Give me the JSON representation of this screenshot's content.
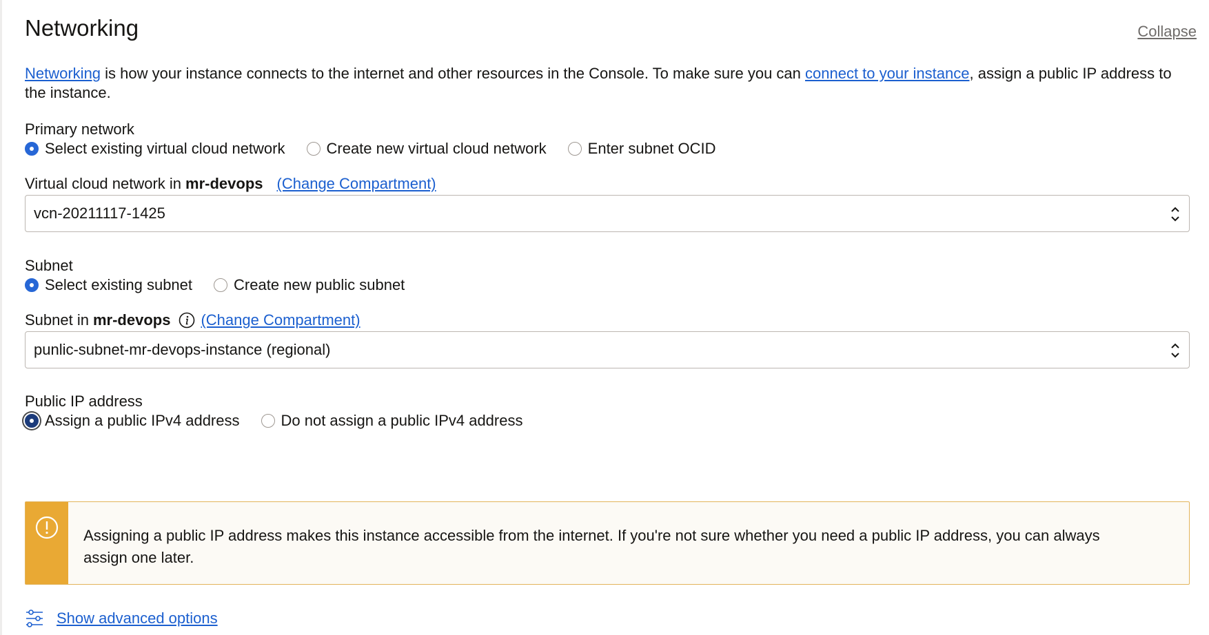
{
  "header": {
    "title": "Networking",
    "collapse_label": "Collapse"
  },
  "intro": {
    "link1": "Networking",
    "text1": " is how your instance connects to the internet and other resources in the Console. To make sure you can ",
    "link2": "connect to your instance",
    "text2": ", assign a public IP address to the instance."
  },
  "primary_network": {
    "label": "Primary network",
    "options": [
      {
        "label": "Select existing virtual cloud network",
        "selected": true
      },
      {
        "label": "Create new virtual cloud network",
        "selected": false
      },
      {
        "label": "Enter subnet OCID",
        "selected": false
      }
    ]
  },
  "vcn_field": {
    "label_prefix": "Virtual cloud network in",
    "compartment": "mr-devops",
    "change_label": "(Change Compartment)",
    "value": "vcn-20211117-1425"
  },
  "subnet": {
    "label": "Subnet",
    "options": [
      {
        "label": "Select existing subnet",
        "selected": true
      },
      {
        "label": "Create new public subnet",
        "selected": false
      }
    ]
  },
  "subnet_field": {
    "label_prefix": "Subnet in",
    "compartment": "mr-devops",
    "change_label": "(Change Compartment)",
    "value": "punlic-subnet-mr-devops-instance (regional)"
  },
  "public_ip": {
    "label": "Public IP address",
    "options": [
      {
        "label": "Assign a public IPv4 address",
        "selected": true
      },
      {
        "label": "Do not assign a public IPv4 address",
        "selected": false
      }
    ]
  },
  "warning": {
    "text": "Assigning a public IP address makes this instance accessible from the internet. If you're not sure whether you need a public IP address, you can always assign one later.",
    "icon": "exclamation-circle-icon",
    "color": "#e9a934"
  },
  "advanced": {
    "label": "Show advanced options",
    "icon": "sliders-icon"
  },
  "colors": {
    "accent": "#2767d6",
    "link": "#1b5fcf"
  }
}
